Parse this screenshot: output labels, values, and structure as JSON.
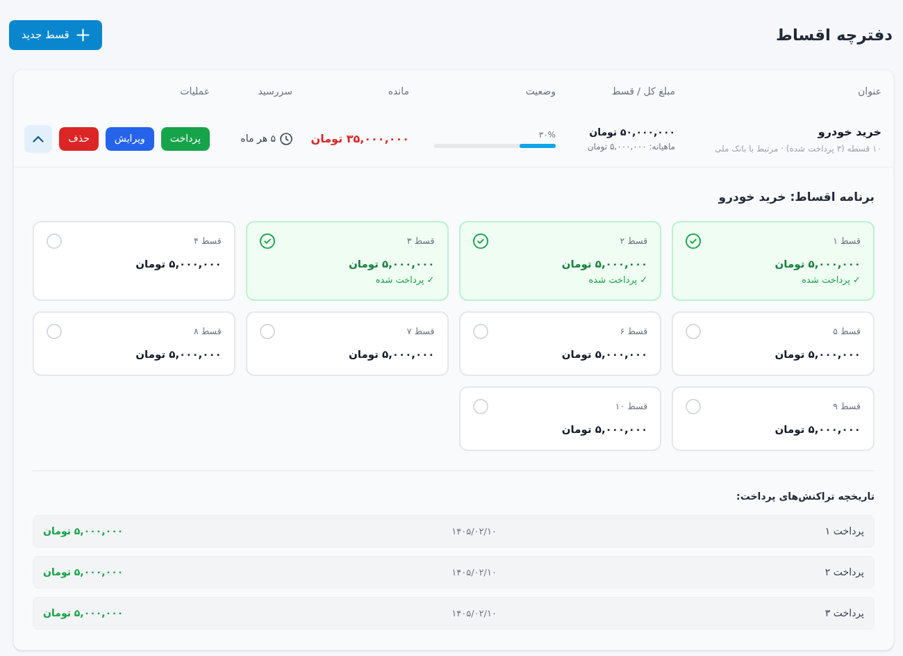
{
  "header": {
    "title": "دفترچه اقساط",
    "new_button": {
      "label": "قسط جدید"
    }
  },
  "table": {
    "columns": [
      "عنوان",
      "مبلغ کل / قسط",
      "وضعیت",
      "مانده",
      "سررسید",
      "عملیات"
    ],
    "rows": [
      {
        "title": "خرید خودرو",
        "subtitle": "۱۰ قسطه (۳ پرداخت شده) · مرتبط با بانک ملی",
        "total": "۵۰,۰۰۰,۰۰۰ تومان",
        "monthly": "ماهیانه: ۵,۰۰۰,۰۰۰ تومان",
        "progress": {
          "reading": "۳۰%",
          "level": 0.3
        },
        "remaining": "۳۵,۰۰۰,۰۰۰ تومان",
        "due": "۵ هر ماه",
        "actions": [
          {
            "label": "پرداخت",
            "kind": "pay"
          },
          {
            "label": "ویرایش",
            "kind": "edit"
          },
          {
            "label": "حذف",
            "kind": "delete"
          }
        ],
        "expanded": true,
        "schedule": {
          "title": "برنامه اقساط: خرید خودرو",
          "installments": [
            {
              "label": "قسط ۱",
              "amount": "۵,۰۰۰,۰۰۰ تومان",
              "paid": true,
              "status": "✓ پرداخت شده"
            },
            {
              "label": "قسط ۲",
              "amount": "۵,۰۰۰,۰۰۰ تومان",
              "paid": true,
              "status": "✓ پرداخت شده"
            },
            {
              "label": "قسط ۳",
              "amount": "۵,۰۰۰,۰۰۰ تومان",
              "paid": true,
              "status": "✓ پرداخت شده"
            },
            {
              "label": "قسط ۴",
              "amount": "۵,۰۰۰,۰۰۰ تومان",
              "paid": false
            },
            {
              "label": "قسط ۵",
              "amount": "۵,۰۰۰,۰۰۰ تومان",
              "paid": false
            },
            {
              "label": "قسط ۶",
              "amount": "۵,۰۰۰,۰۰۰ تومان",
              "paid": false
            },
            {
              "label": "قسط ۷",
              "amount": "۵,۰۰۰,۰۰۰ تومان",
              "paid": false
            },
            {
              "label": "قسط ۸",
              "amount": "۵,۰۰۰,۰۰۰ تومان",
              "paid": false
            },
            {
              "label": "قسط ۹",
              "amount": "۵,۰۰۰,۰۰۰ تومان",
              "paid": false
            },
            {
              "label": "قسط ۱۰",
              "amount": "۵,۰۰۰,۰۰۰ تومان",
              "paid": false
            }
          ]
        },
        "history": {
          "title": "تاریخچه تراکنش‌های پرداخت:",
          "transactions": [
            {
              "label": "پرداخت ۱",
              "date": "۱۴۰۵/۰۲/۱۰",
              "amount": "۵,۰۰۰,۰۰۰ تومان"
            },
            {
              "label": "پرداخت ۲",
              "date": "۱۴۰۵/۰۲/۱۰",
              "amount": "۵,۰۰۰,۰۰۰ تومان"
            },
            {
              "label": "پرداخت ۳",
              "date": "۱۴۰۵/۰۲/۱۰",
              "amount": "۵,۰۰۰,۰۰۰ تومان"
            }
          ]
        }
      }
    ]
  }
}
